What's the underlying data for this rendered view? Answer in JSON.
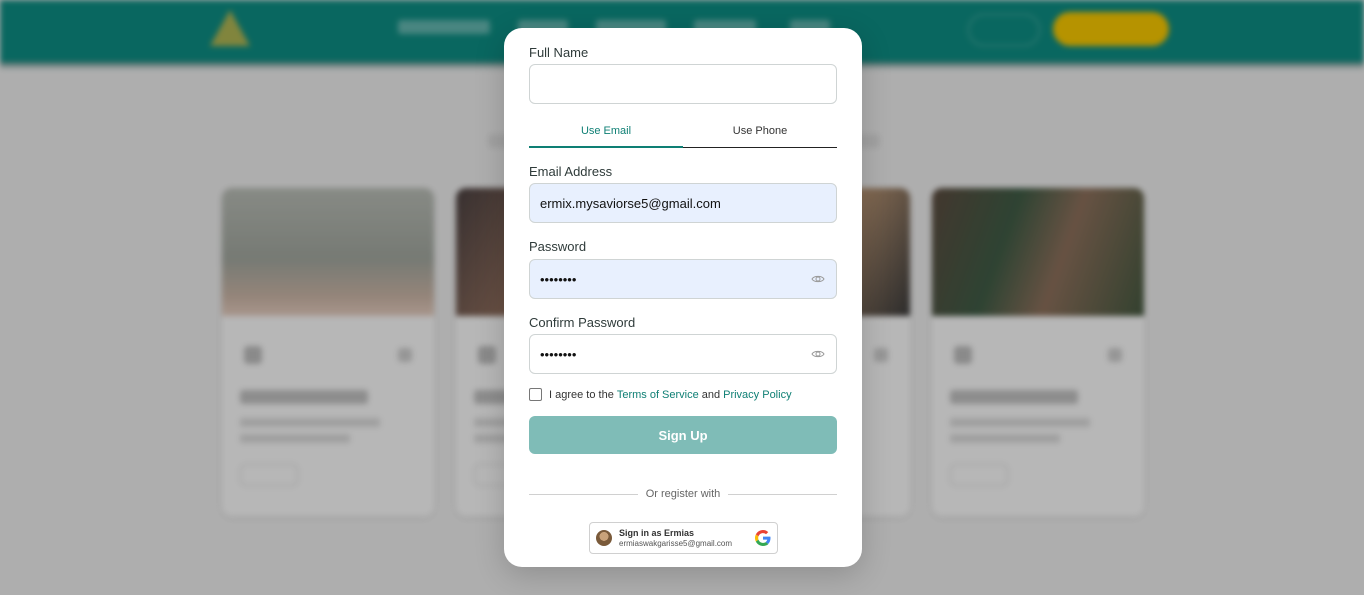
{
  "form": {
    "full_name_label": "Full Name",
    "full_name_value": "",
    "tabs": [
      {
        "label": "Use Email",
        "active": true
      },
      {
        "label": "Use Phone",
        "active": false
      }
    ],
    "email_label": "Email Address",
    "email_value": "ermix.mysaviorse5@gmail.com",
    "password_label": "Password",
    "password_value": "••••••••",
    "confirm_password_label": "Confirm Password",
    "confirm_password_value": "••••••••",
    "agree_prefix": "I agree to the",
    "terms_link": "Terms of Service",
    "agree_and": "and",
    "privacy_link": "Privacy Policy",
    "agree_checked": false,
    "signup_label": "Sign Up",
    "divider_text": "Or register with"
  },
  "google": {
    "name": "Sign in as Ermias",
    "email": "ermiaswakgarisse5@gmail.com"
  },
  "colors": {
    "brand": "#0e7f74",
    "header": "#0d8a80",
    "cta": "#f3c400",
    "signup_disabled": "#7fbcb7",
    "autofill": "#e8f0fe"
  },
  "icons": [
    "eye-icon",
    "google-icon",
    "avatar"
  ]
}
